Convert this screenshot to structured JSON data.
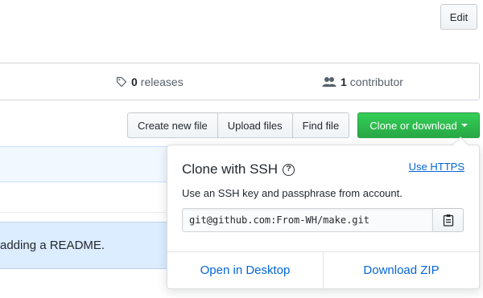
{
  "header": {
    "edit_label": "Edit"
  },
  "summary": {
    "releases_count": "0",
    "releases_label": "releases",
    "contributors_count": "1",
    "contributors_label": "contributor"
  },
  "file_actions": {
    "create_label": "Create new file",
    "upload_label": "Upload files",
    "find_label": "Find file",
    "clone_label": "Clone or download"
  },
  "readme_banner": {
    "text": "adding a README."
  },
  "clone_dropdown": {
    "title": "Clone with SSH",
    "help_glyph": "?",
    "switch_link": "Use HTTPS",
    "description": "Use an SSH key and passphrase from account.",
    "ssh_url": "git@github.com:From-WH/make.git",
    "open_desktop": "Open in Desktop",
    "download_zip": "Download ZIP"
  },
  "colors": {
    "primary_green": "#28a745",
    "link_blue": "#0366d6",
    "banner_blue": "#dbedff"
  },
  "icons": [
    "tag-icon",
    "people-icon",
    "clipboard-icon",
    "question-icon",
    "caret-down-icon"
  ]
}
